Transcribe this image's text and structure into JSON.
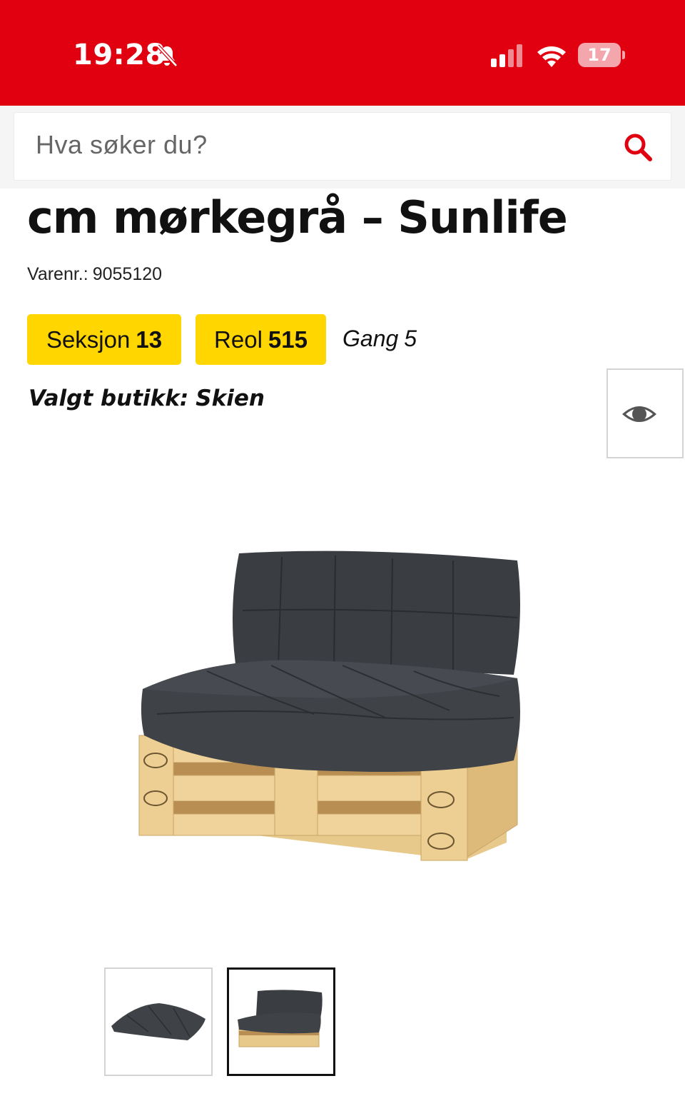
{
  "status_bar": {
    "time": "19:28",
    "battery": "17",
    "icons": [
      "bell-muted-icon",
      "cellular-signal-icon",
      "wifi-icon",
      "battery-icon"
    ]
  },
  "search": {
    "placeholder": "Hva søker du?",
    "icon": "search-icon"
  },
  "product": {
    "title": "cm mørkegrå – Sunlife",
    "sku_label": "Varenr.:",
    "sku_value": "9055120"
  },
  "location": {
    "section_label": "Seksjon",
    "section_value": "13",
    "shelf_label": "Reol",
    "shelf_value": "515",
    "aisle_label": "Gang",
    "aisle_value": "5",
    "store_label": "Valgt butikk:",
    "store_value": "Skien"
  },
  "gallery": {
    "thumbnail_count": 2,
    "selected_index": 1,
    "view_icon": "eye-icon"
  },
  "colors": {
    "brand_red": "#e0000f",
    "badge_yellow": "#ffd600",
    "cushion_gray": "#3a3d42",
    "pallet_wood": "#e8c98c"
  }
}
